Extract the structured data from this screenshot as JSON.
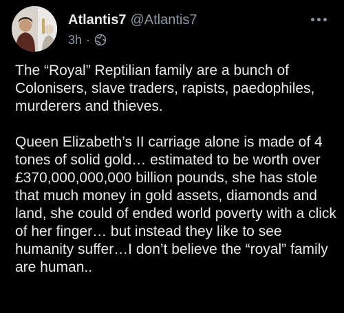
{
  "post": {
    "author": {
      "display_name": "Atlantis7",
      "handle": "@Atlantis7"
    },
    "timestamp": "3h",
    "separator": "·",
    "audience_icon": "globe-icon",
    "more_icon": "more-dots-icon",
    "body": {
      "paragraph_1": "The “Royal” Reptilian family are a bunch of Colonisers, slave traders, rapists, paedophiles, murderers and thieves.",
      "paragraph_2": "Queen Elizabeth’s II carriage alone is made of 4 tones of solid gold… estimated to be worth over £370,000,000,000 billion pounds, she has stole that much money in gold assets, diamonds and land, she could of ended world poverty with a click of her finger… but instead they like to see humanity suffer…I don’t believe the “royal” family are human.."
    }
  },
  "colors": {
    "background": "#000000",
    "primary_text": "#e7e9ea",
    "secondary_text": "#8b98a5"
  }
}
